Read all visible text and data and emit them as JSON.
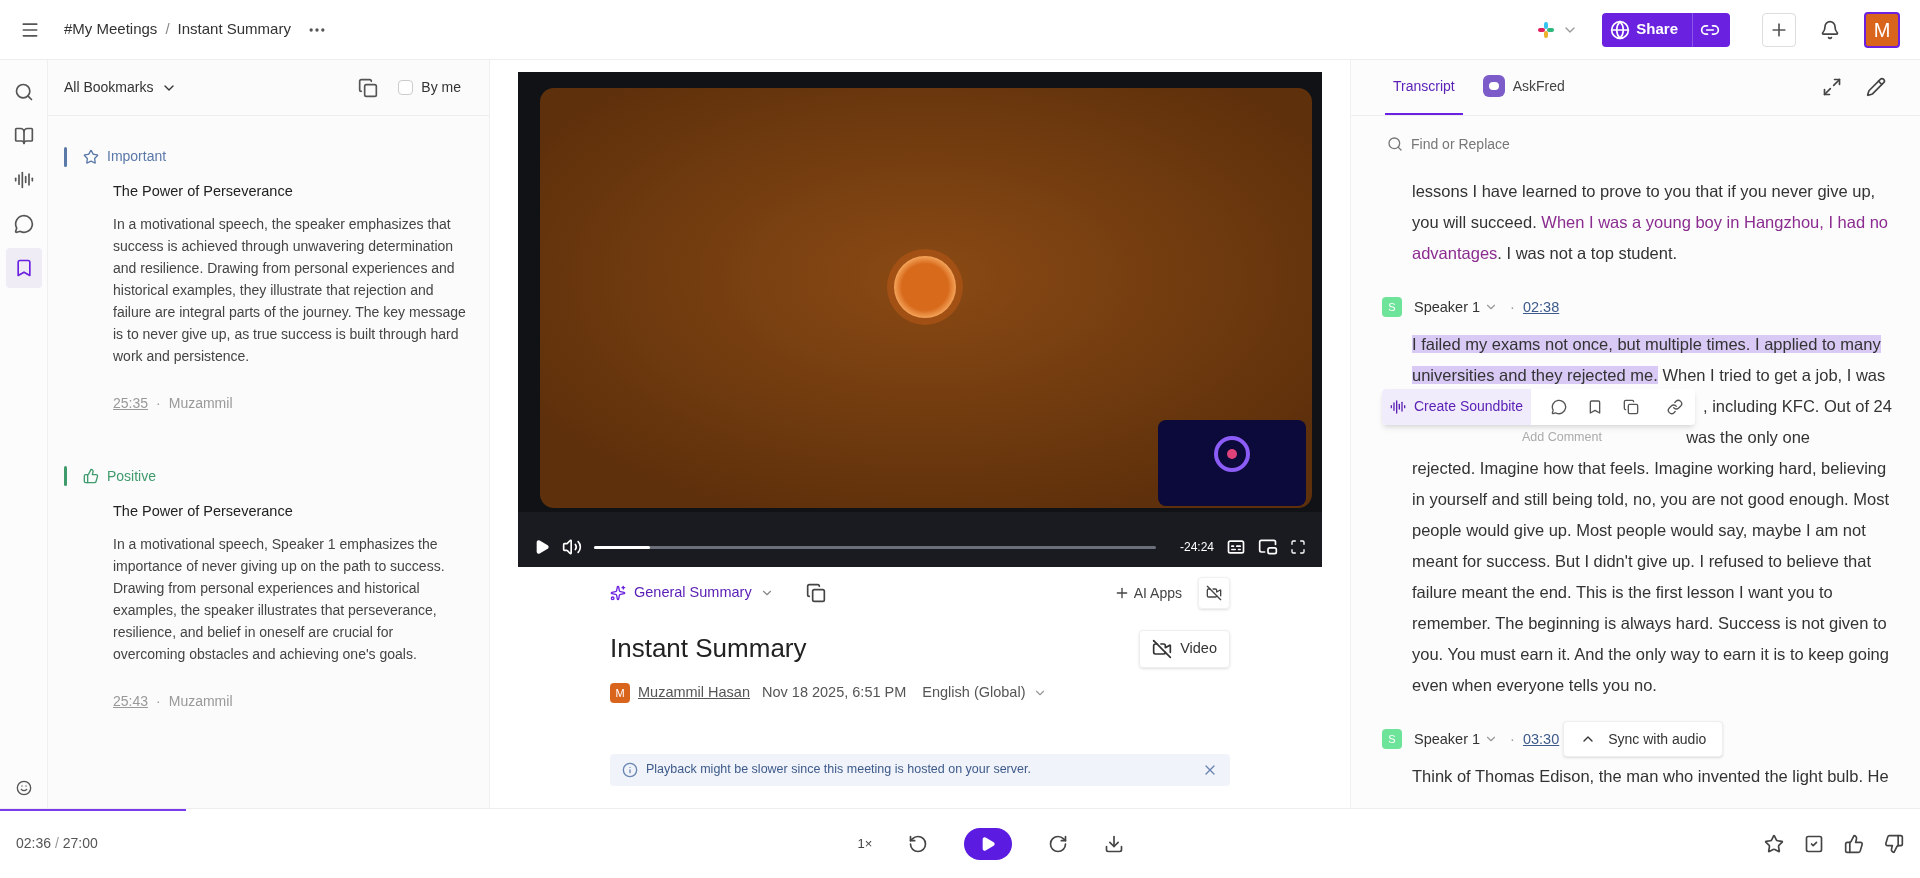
{
  "breadcrumb_separator": "/",
  "breadcrumb": [
    {
      "label": "#My Meetings"
    },
    {
      "label": "Instant Summary"
    }
  ],
  "share": {
    "label": "Share"
  },
  "avatar": {
    "initial": "M"
  },
  "rail": [
    {
      "kind": "search",
      "selected": false
    },
    {
      "kind": "book",
      "selected": false
    },
    {
      "kind": "audio",
      "selected": false
    },
    {
      "kind": "chat",
      "selected": false
    },
    {
      "kind": "bookmark",
      "selected": true
    }
  ],
  "bookmarks": {
    "filter": "All Bookmarks",
    "by_me": {
      "label": "By me",
      "checked": false
    },
    "items": [
      {
        "kind": "star",
        "tag": "Important",
        "color": "#5a78a8",
        "title": "The Power of Perseverance",
        "body": "In a motivational speech, the speaker emphasizes that success is achieved through unwavering determination and resilience. Drawing from personal experiences and historical examples, they illustrate that rejection and failure are integral parts of the journey. The key message is to never give up, as true success is built through hard work and persistence.",
        "time": "25:35",
        "dot": "·",
        "author": "Muzammil"
      },
      {
        "kind": "thumb",
        "tag": "Positive",
        "color": "#3f9a6c",
        "title": "The Power of Perseverance",
        "body": "In a motivational speech, Speaker 1 emphasizes the importance of never giving up on the path to success. Drawing from personal experiences and historical examples, the speaker illustrates that perseverance, resilience, and belief in oneself are crucial for overcoming obstacles and achieving one's goals.",
        "time": "25:43",
        "dot": "·",
        "author": "Muzammil"
      }
    ]
  },
  "player": {
    "remaining": "-24:24",
    "level": 0.1
  },
  "summary": {
    "selector": "General Summary",
    "ai_apps": "AI Apps",
    "title": "Instant Summary",
    "video_button": "Video",
    "author_initial": "M",
    "author": "Muzammil Hasan",
    "date": "Nov 18 2025, 6:51 PM",
    "language": "English (Global)",
    "notice": "Playback might be slower since this meeting is hosted on your server."
  },
  "transcript": {
    "tabs": [
      {
        "label": "Transcript",
        "selected": true
      },
      {
        "label": "AskFred",
        "selected": false
      }
    ],
    "search_placeholder": "Find or Replace",
    "intro": [
      {
        "kind": "plain",
        "text": "lessons I have learned to prove to you that if you never give up, you will succeed. "
      },
      {
        "kind": "quote",
        "text": "When I was a young boy in Hangzhou, I had no advantages"
      },
      {
        "kind": "plain",
        "text": ". I was not a top student."
      }
    ],
    "blocks": [
      {
        "speaker": "Speaker 1",
        "initial": "S",
        "time": "02:38",
        "dot": "·",
        "before": [
          {
            "kind": "selected",
            "text": "I failed my exams not once, but multiple times. I applied to many universities and they rejected me."
          },
          {
            "kind": "plain",
            "text": " When I tried to get a job, I was"
          }
        ],
        "toolbar": {
          "soundbite": "Create Soundbite",
          "after": ", including KFC. Out of 24",
          "partial": "was the only one",
          "tooltip": "Add Comment"
        },
        "after": "rejected. Imagine how that feels. Imagine working hard, believing in yourself and still being told, no, you are not good enough. Most people would give up. Most people would say, maybe I am not meant for success. But I didn't give up. I refused to believe that failure meant the end. This is the first lesson I want you to remember. The beginning is always hard. Success is not given to you. You must earn it. And the only way to earn it is to keep going even when everyone tells you no."
      },
      {
        "speaker": "Speaker 1",
        "initial": "S",
        "time": "03:30",
        "dot": "·",
        "sync": "Sync with audio",
        "after": "Think of Thomas Edison, the man who invented the light bulb. He"
      }
    ]
  },
  "footer": {
    "position": "02:36",
    "separator": "/",
    "duration": "27:00",
    "level": 0.097,
    "speed": "1×"
  }
}
